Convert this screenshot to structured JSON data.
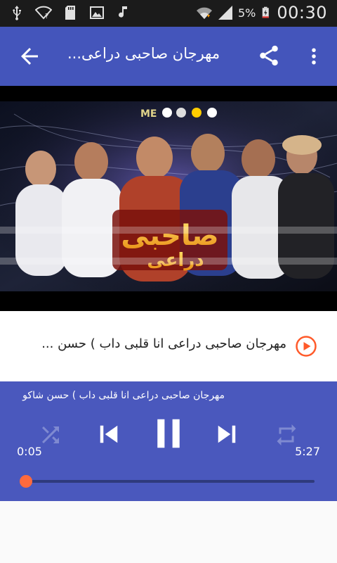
{
  "status_bar": {
    "battery_percent": "5%",
    "time": "00:30",
    "icons": [
      "usb-icon",
      "wifi-question-icon",
      "sd-card-icon",
      "image-icon",
      "music-note-icon",
      "wifi-icon",
      "signal-icon",
      "battery-charging-icon"
    ]
  },
  "app_bar": {
    "title": "مهرجان صاحبى دراعى...",
    "back_icon": "arrow-back-icon",
    "share_icon": "share-icon",
    "more_icon": "more-vert-icon"
  },
  "artwork": {
    "top_logo": "ME"
  },
  "track": {
    "title": "مهرجان صاحبى دراعى        انا قلبى داب ) حسن ...",
    "icon": "play-circle-icon"
  },
  "player": {
    "now_playing": "مهرجان صاحبى دراعى        انا قلبى داب ) حسن شاكو",
    "current_time": "0:05",
    "total_time": "5:27",
    "progress_fraction": 0.016,
    "controls": [
      "shuffle-icon",
      "skip-previous-icon",
      "pause-icon",
      "skip-next-icon",
      "repeat-icon"
    ]
  },
  "colors": {
    "app_bar": "#4455bb",
    "player_bg": "#4a58bd",
    "accent": "#ff6a3d",
    "status_bar": "#1b1b1b"
  }
}
